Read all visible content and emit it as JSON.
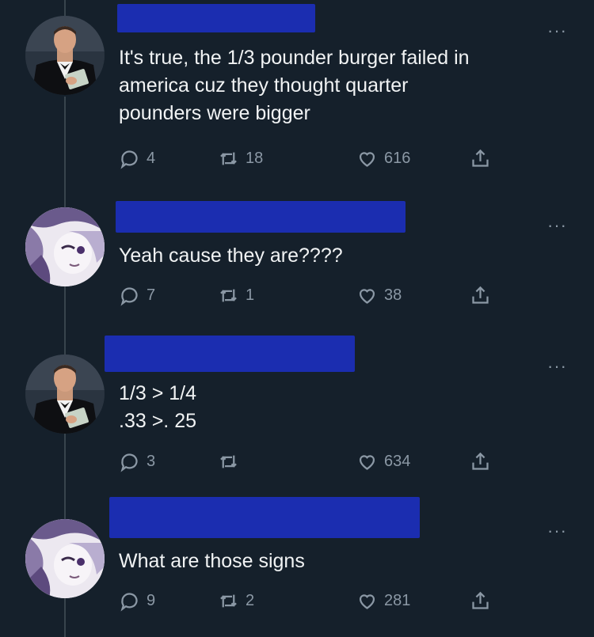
{
  "tweets": [
    {
      "author_type": "human",
      "more_label": "···",
      "text": "It's true, the 1/3 pounder burger failed in\namerica cuz they thought quarter\npounders were bigger",
      "replies": "4",
      "retweets": "18",
      "likes": "616"
    },
    {
      "author_type": "anime",
      "more_label": "···",
      "text": "Yeah cause they are????",
      "replies": "7",
      "retweets": "1",
      "likes": "38"
    },
    {
      "author_type": "human",
      "more_label": "···",
      "text": "1/3 > 1/4\n.33 >. 25",
      "replies": "3",
      "retweets": "",
      "likes": "634"
    },
    {
      "author_type": "anime",
      "more_label": "···",
      "text": "What are those signs",
      "replies": "9",
      "retweets": "2",
      "likes": "281"
    }
  ],
  "icons": {
    "reply": "reply-icon",
    "retweet": "retweet-icon",
    "like": "heart-icon",
    "share": "share-icon",
    "more": "more-icon"
  },
  "colors": {
    "background": "#15202b",
    "text": "#e7e9ea",
    "muted": "#8b98a5",
    "redaction": "#1b2db0"
  }
}
